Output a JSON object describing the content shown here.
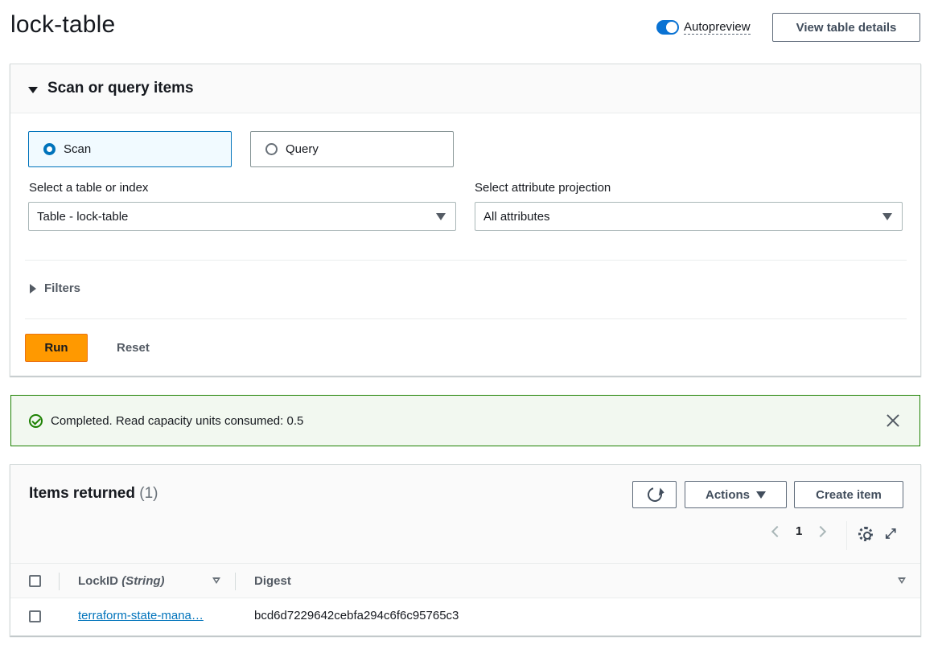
{
  "header": {
    "title": "lock-table",
    "autopreview_label": "Autopreview",
    "view_details_label": "View table details"
  },
  "scan": {
    "title": "Scan or query items",
    "mode_scan": "Scan",
    "mode_query": "Query",
    "table_label": "Select a table or index",
    "table_value": "Table - lock-table",
    "projection_label": "Select attribute projection",
    "projection_value": "All attributes",
    "filters_label": "Filters",
    "run_label": "Run",
    "reset_label": "Reset"
  },
  "alert": {
    "message": "Completed. Read capacity units consumed: 0.5"
  },
  "items": {
    "title": "Items returned",
    "count": "(1)",
    "actions_label": "Actions",
    "create_label": "Create item",
    "page": "1",
    "columns": {
      "lockid_name": "LockID",
      "lockid_type": "(String)",
      "digest": "Digest"
    },
    "rows": [
      {
        "lockid": "terraform-state-mana…",
        "digest": "bcd6d7229642cebfa294c6f6c95765c3"
      }
    ]
  },
  "colors": {
    "primary_orange": "#ff9900",
    "link_blue": "#0073bb",
    "success_green": "#1d8102"
  }
}
